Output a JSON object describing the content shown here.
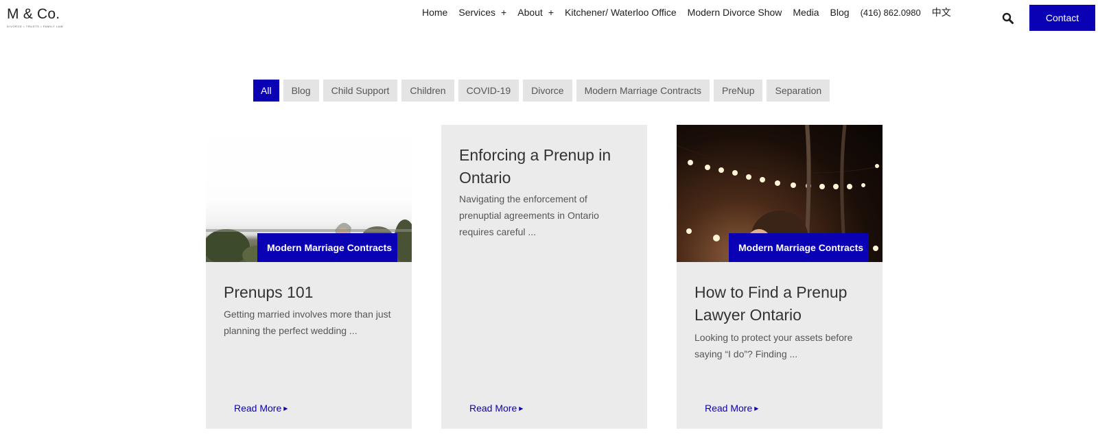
{
  "logo": {
    "text": "M & Co.",
    "tagline": "DIVORCE • TRUSTS • FAMILY LAW"
  },
  "nav": {
    "home": "Home",
    "services": "Services",
    "about": "About",
    "expand_symbol": "+",
    "kitchener": "Kitchener/ Waterloo Office",
    "show": "Modern Divorce Show",
    "media": "Media",
    "blog": "Blog",
    "phone": "(416) 862.0980",
    "chinese": "中文",
    "contact": "Contact"
  },
  "filters": [
    "All",
    "Blog",
    "Child Support",
    "Children",
    "COVID-19",
    "Divorce",
    "Modern Marriage Contracts",
    "PreNup",
    "Separation"
  ],
  "active_filter": "All",
  "cards": [
    {
      "badge": "Modern Marriage Contracts",
      "title": "Prenups 101",
      "excerpt": "Getting married involves more than just planning the perfect wedding ...",
      "read_more": "Read More"
    },
    {
      "title": "Enforcing a Prenup in Ontario",
      "excerpt": "Navigating the enforcement of prenuptial agreements in Ontario requires careful ...",
      "read_more": "Read More"
    },
    {
      "badge": "Modern Marriage Contracts",
      "title": "How to Find a Prenup Lawyer Ontario",
      "excerpt": "Looking to protect your assets before saying “I do”? Finding ...",
      "read_more": "Read More"
    }
  ],
  "colors": {
    "accent": "#0a00b4",
    "card_bg": "#ebebeb",
    "filter_bg": "#e4e4e4"
  }
}
